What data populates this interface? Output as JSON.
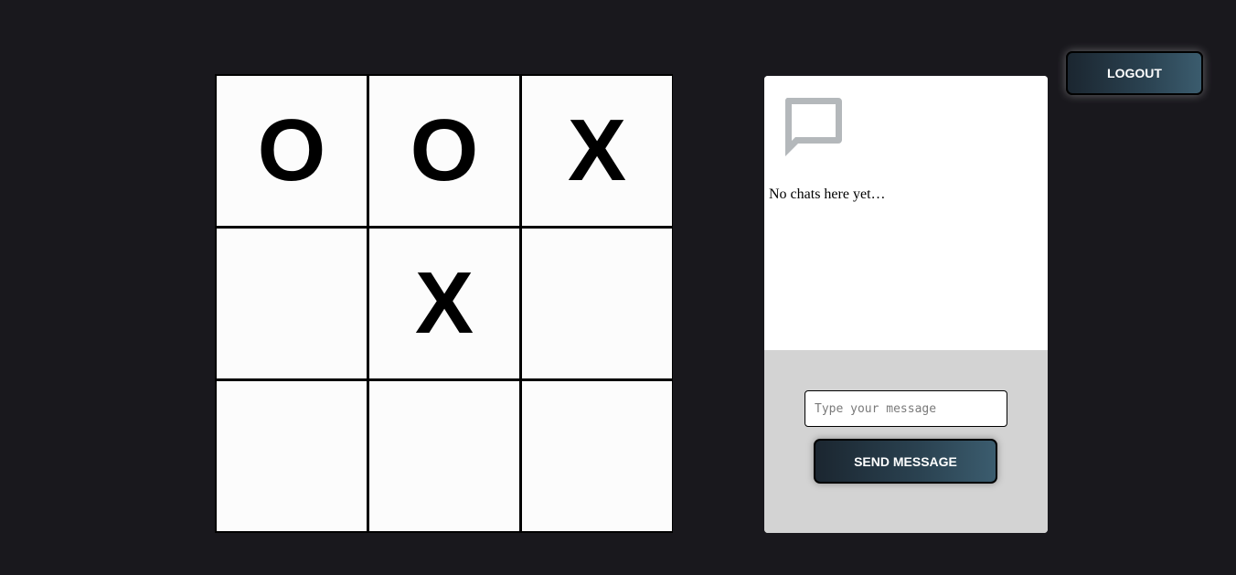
{
  "header": {
    "logout_label": "LOGOUT"
  },
  "board": {
    "cells": [
      "O",
      "O",
      "X",
      "",
      "X",
      "",
      "",
      "",
      ""
    ]
  },
  "chat": {
    "empty_icon": "chat-bubble-icon",
    "empty_text": "No chats here yet…",
    "input_value": "",
    "input_placeholder": "Type your message",
    "send_label": "SEND MESSAGE"
  },
  "colors": {
    "background": "#19181d",
    "cell": "#fcfcfc",
    "chat_footer": "#d3d3d3",
    "icon_gray": "#b4b8bb",
    "button_gradient_start": "#1b2630",
    "button_gradient_end": "#3b5c6e"
  }
}
